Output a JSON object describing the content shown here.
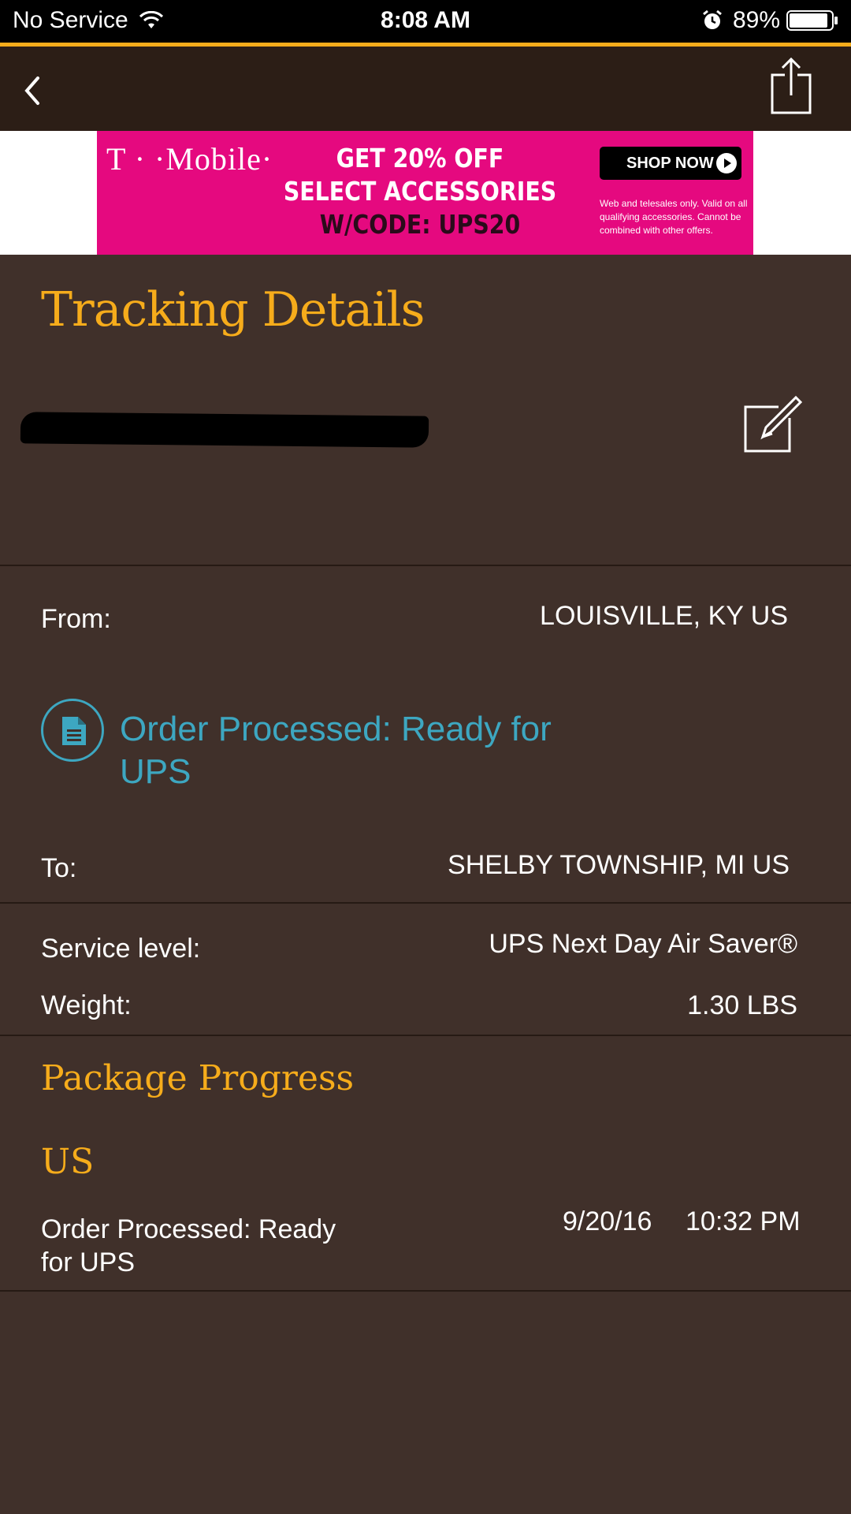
{
  "status_bar": {
    "carrier": "No Service",
    "time": "8:08 AM",
    "battery": "89%",
    "icons": [
      "wifi-icon",
      "alarm-icon",
      "battery-icon"
    ]
  },
  "nav": {
    "back_icon": "chevron-left-icon",
    "share_icon": "share-icon"
  },
  "ad": {
    "brand": "T · ·Mobile·",
    "headline_line1": "GET 20% OFF",
    "headline_line2": "SELECT ACCESSORIES",
    "headline_line3": "W/CODE: UPS20",
    "cta": "SHOP NOW",
    "fine_print": "Web and telesales only. Valid on all qualifying accessories. Cannot be combined with other offers.",
    "background_color": "#e5097f"
  },
  "page": {
    "title": "Tracking Details"
  },
  "shipment": {
    "from_label": "From:",
    "from_value": "LOUISVILLE, KY US",
    "status": "Order Processed: Ready for UPS",
    "status_icon": "document-icon",
    "to_label": "To:",
    "to_value": "SHELBY TOWNSHIP, MI US",
    "service_label": "Service level:",
    "service_value": "UPS Next Day Air Saver®",
    "weight_label": "Weight:",
    "weight_value": "1.30 LBS"
  },
  "progress": {
    "title": "Package Progress",
    "location": "US",
    "activities": [
      {
        "description": "Order Processed: Ready for UPS",
        "date": "9/20/16",
        "time": "10:32 PM"
      }
    ]
  },
  "colors": {
    "accent": "#f6ac1b",
    "status_blue": "#3da7c1",
    "background": "#40302a",
    "nav_background": "#2c1e16"
  }
}
